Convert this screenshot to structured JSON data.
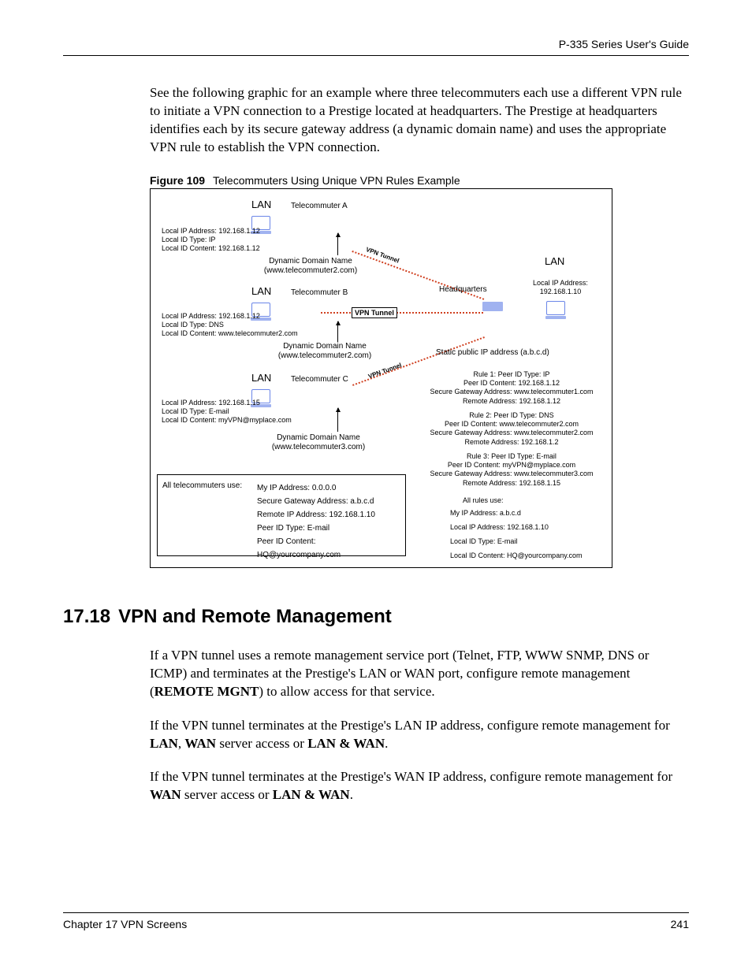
{
  "header": {
    "guide_title": "P-335 Series User's Guide"
  },
  "intro": "See the following graphic for an example where three telecommuters each use a different VPN rule to initiate a VPN connection to a Prestige located at headquarters. The Prestige at headquarters identifies each by its secure gateway address (a dynamic domain name) and uses the appropriate VPN rule to establish the VPN connection.",
  "figure": {
    "label": "Figure 109",
    "caption": "Telecommuters Using Unique VPN Rules Example",
    "lan": "LAN",
    "telecommuter_a": "Telecommuter A",
    "telecommuter_b": "Telecommuter B",
    "telecommuter_c": "Telecommuter C",
    "headquarters": "Headquarters",
    "vpn_tunnel": "VPN Tunnel",
    "local_a": "Local IP Address: 192.168.1.12\nLocal ID Type: IP\nLocal ID Content: 192.168.1.12",
    "local_b": "Local IP Address: 192.168.1.12\nLocal ID Type: DNS\nLocal ID Content: www.telecommuter2.com",
    "local_c": "Local IP Address: 192.168.1.15\nLocal ID Type: E-mail\nLocal ID Content: myVPN@myplace.com",
    "ddn1_l1": "Dynamic Domain Name",
    "ddn1_l2": "(www.telecommuter2.com)",
    "ddn2_l1": "Dynamic Domain Name",
    "ddn2_l2": "(www.telecommuter2.com)",
    "ddn3_l1": "Dynamic Domain Name",
    "ddn3_l2": "(www.telecommuter3.com)",
    "hq_local_l1": "Local IP Address:",
    "hq_local_l2": "192.168.1.10",
    "static_ip": "Static public IP address (a.b.c.d)",
    "rule1": "Rule 1: Peer ID Type: IP\nPeer ID Content: 192.168.1.12\nSecure Gateway Address: www.telecommuter1.com\nRemote Address: 192.168.1.12",
    "rule2": "Rule 2: Peer ID Type: DNS\nPeer ID Content: www.telecommuter2.com\nSecure Gateway Address: www.telecommuter2.com\nRemote Address: 192.168.1.2",
    "rule3": "Rule 3: Peer ID Type: E-mail\nPeer ID Content: myVPN@myplace.com\nSecure Gateway Address: www.telecommuter3.com\nRemote Address: 192.168.1.15",
    "all_rules_l0": "All rules use:",
    "all_rules_l1": "My IP Address: a.b.c.d",
    "all_rules_l2": "Local IP Address: 192.168.1.10",
    "all_rules_l3": "Local ID Type: E-mail",
    "all_rules_l4": "Local ID Content: HQ@yourcompany.com",
    "leftbox_title": "All telecommuters use:",
    "leftbox_l1": "My IP Address: 0.0.0.0",
    "leftbox_l2": "Secure Gateway Address: a.b.c.d",
    "leftbox_l3": "Remote IP Address: 192.168.1.10",
    "leftbox_l4": "Peer  ID Type: E-mail",
    "leftbox_l5": "Peer ID Content: HQ@yourcompany.com"
  },
  "section": {
    "number": "17.18",
    "title": "VPN and Remote Management",
    "p1_a": "If a VPN tunnel uses a remote management service port (Telnet, FTP, WWW SNMP, DNS or ICMP) and terminates at the Prestige's LAN or WAN port, configure remote management (",
    "p1_b": "REMOTE MGNT",
    "p1_c": ") to allow access for that service.",
    "p2_a": "If the VPN tunnel terminates at the Prestige's LAN IP address, configure remote management for ",
    "p2_b": "LAN",
    "p2_c": ", ",
    "p2_d": "WAN",
    "p2_e": " server access or ",
    "p2_f": "LAN & WAN",
    "p2_g": ".",
    "p3_a": "If the VPN tunnel terminates at the Prestige's WAN IP address, configure remote management for ",
    "p3_b": "WAN",
    "p3_c": " server access or ",
    "p3_d": "LAN & WAN",
    "p3_e": "."
  },
  "footer": {
    "chapter": "Chapter 17 VPN Screens",
    "page": "241"
  }
}
